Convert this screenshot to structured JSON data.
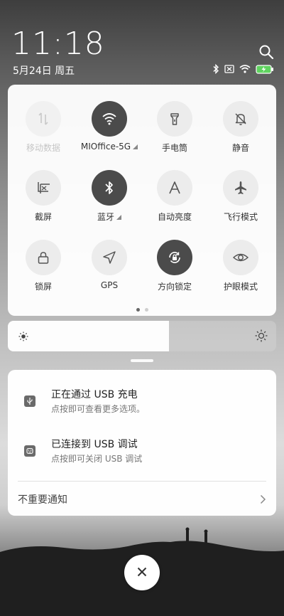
{
  "status_bar": {
    "time": "11:18",
    "date": "5月24日 周五",
    "icons": [
      "bluetooth-icon",
      "no-sim-icon",
      "wifi-icon",
      "battery-charging-icon"
    ]
  },
  "quick_settings": {
    "tiles": [
      {
        "label": "移动数据",
        "icon": "mobile-data-icon",
        "state": "disabled"
      },
      {
        "label": "MIOffice-5G",
        "icon": "wifi-icon",
        "state": "on"
      },
      {
        "label": "手电筒",
        "icon": "flashlight-icon",
        "state": "off"
      },
      {
        "label": "静音",
        "icon": "silent-icon",
        "state": "off"
      },
      {
        "label": "截屏",
        "icon": "screenshot-icon",
        "state": "off"
      },
      {
        "label": "蓝牙",
        "icon": "bluetooth-icon",
        "state": "on"
      },
      {
        "label": "自动亮度",
        "icon": "auto-brightness-icon",
        "state": "off"
      },
      {
        "label": "飞行模式",
        "icon": "airplane-icon",
        "state": "off"
      },
      {
        "label": "锁屏",
        "icon": "lock-icon",
        "state": "off"
      },
      {
        "label": "GPS",
        "icon": "gps-icon",
        "state": "off"
      },
      {
        "label": "方向锁定",
        "icon": "rotation-lock-icon",
        "state": "on"
      },
      {
        "label": "护眼模式",
        "icon": "eye-icon",
        "state": "off"
      }
    ],
    "page_count": 2,
    "current_page": 1
  },
  "brightness": {
    "level": 0.6
  },
  "notifications": [
    {
      "title": "正在通过  USB  充电",
      "subtitle": "点按即可查看更多选项。",
      "icon": "usb-icon"
    },
    {
      "title": "已连接到  USB  调试",
      "subtitle": "点按即可关闭 USB 调试",
      "icon": "android-debug-icon"
    }
  ],
  "unimportant_label": "不重要通知",
  "colors": {
    "tile_on": "#4b4b4b",
    "tile_off": "#ececec",
    "panel": "#ffffff"
  }
}
